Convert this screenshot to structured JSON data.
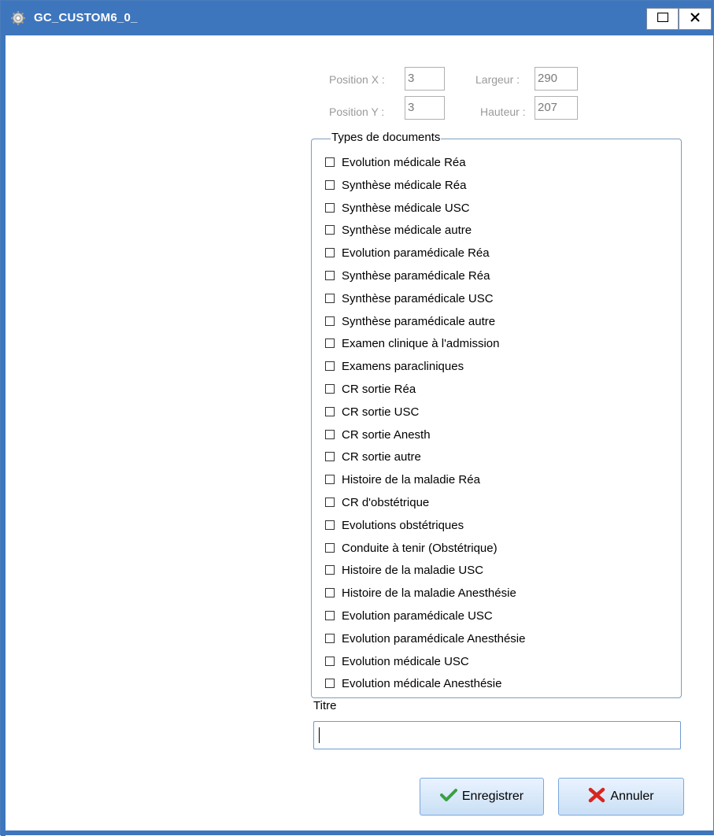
{
  "window": {
    "title": "GC_CUSTOM6_0_",
    "controls": {
      "maximize_icon": "maximize-icon",
      "close_icon": "close-icon"
    }
  },
  "position": {
    "x_label": "Position X :",
    "x_value": "3",
    "y_label": "Position Y :",
    "y_value": "3",
    "width_label": "Largeur :",
    "width_value": "290",
    "height_label": "Hauteur :",
    "height_value": "207"
  },
  "document_types": {
    "legend": "Types de documents",
    "items": [
      "Evolution médicale Réa",
      "Synthèse médicale Réa",
      "Synthèse médicale USC",
      "Synthèse médicale autre",
      "Evolution paramédicale Réa",
      "Synthèse paramédicale Réa",
      "Synthèse paramédicale USC",
      "Synthèse paramédicale autre",
      "Examen clinique à l'admission",
      "Examens paracliniques",
      "CR sortie Réa",
      "CR sortie USC",
      "CR sortie Anesth",
      "CR sortie autre",
      "Histoire de la maladie Réa",
      "CR d'obstétrique",
      "Evolutions obstétriques",
      "Conduite à tenir (Obstétrique)",
      "Histoire de la maladie USC",
      "Histoire de la maladie Anesthésie",
      "Evolution paramédicale USC",
      "Evolution paramédicale Anesthésie",
      "Evolution médicale USC",
      "Evolution médicale Anesthésie"
    ]
  },
  "titre": {
    "label": "Titre",
    "value": ""
  },
  "buttons": {
    "save": "Enregistrer",
    "cancel": "Annuler"
  },
  "colors": {
    "titlebar": "#3e76bd",
    "save_check": "#3aa043",
    "cancel_x": "#d7261e"
  }
}
